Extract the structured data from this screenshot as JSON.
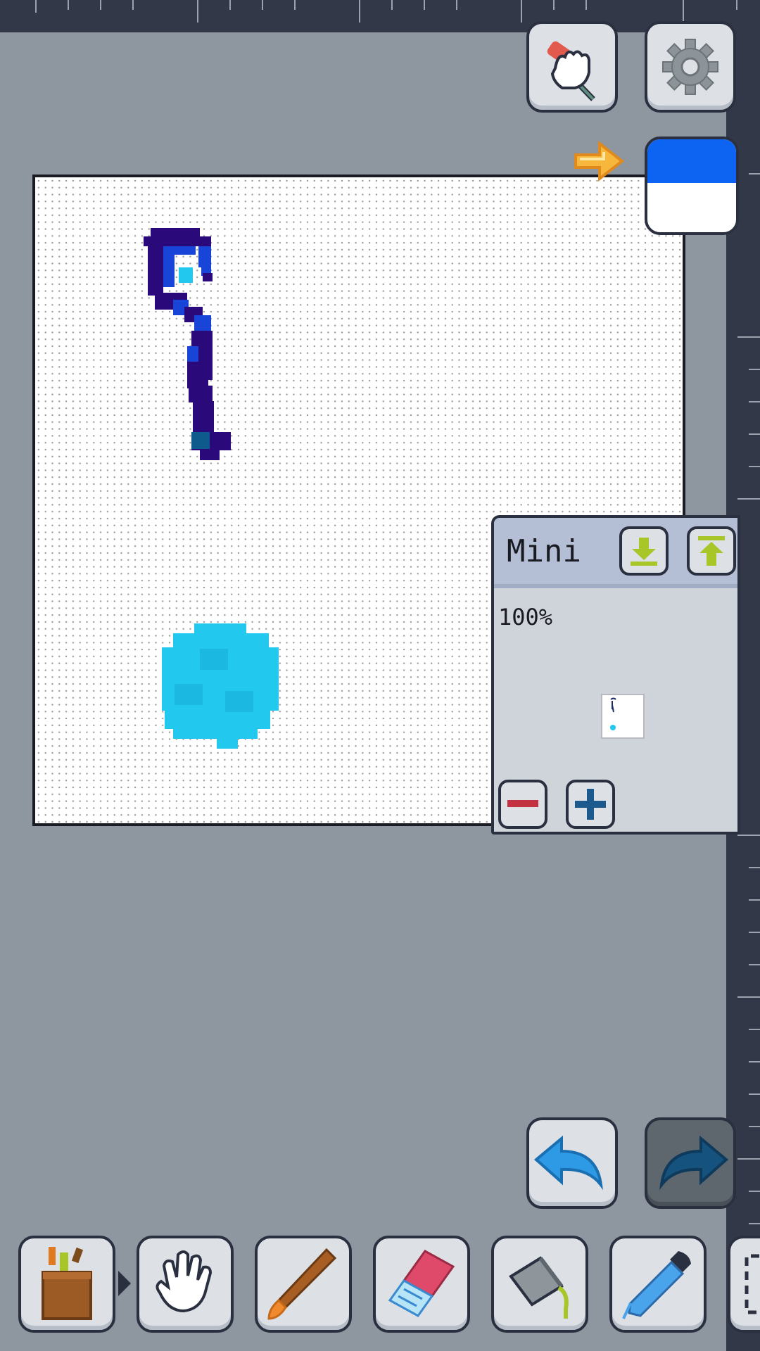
{
  "top_buttons": {
    "edit_tools": "edit-tools-icon",
    "settings": "gear-icon"
  },
  "color": {
    "primary": "#0d63f2",
    "secondary": "#ffffff",
    "indicator": "arrow-right-icon"
  },
  "mini_panel": {
    "title": "Mini",
    "zoom": "100%",
    "buttons": [
      "download-icon",
      "upload-icon",
      "zoom-out-icon",
      "zoom-in-icon"
    ]
  },
  "history": {
    "undo": "undo-icon",
    "redo": "redo-icon"
  },
  "toolbar": {
    "tools": [
      "toolbox-icon",
      "hand-icon",
      "brush-icon",
      "eraser-icon",
      "bucket-icon",
      "eyedropper-icon",
      "select-icon"
    ]
  },
  "drawing": {
    "colors": {
      "dark": "#2a0a7a",
      "mid": "#1845d8",
      "cyan": "#22c8ee",
      "teal": "#0f5a8c"
    }
  }
}
